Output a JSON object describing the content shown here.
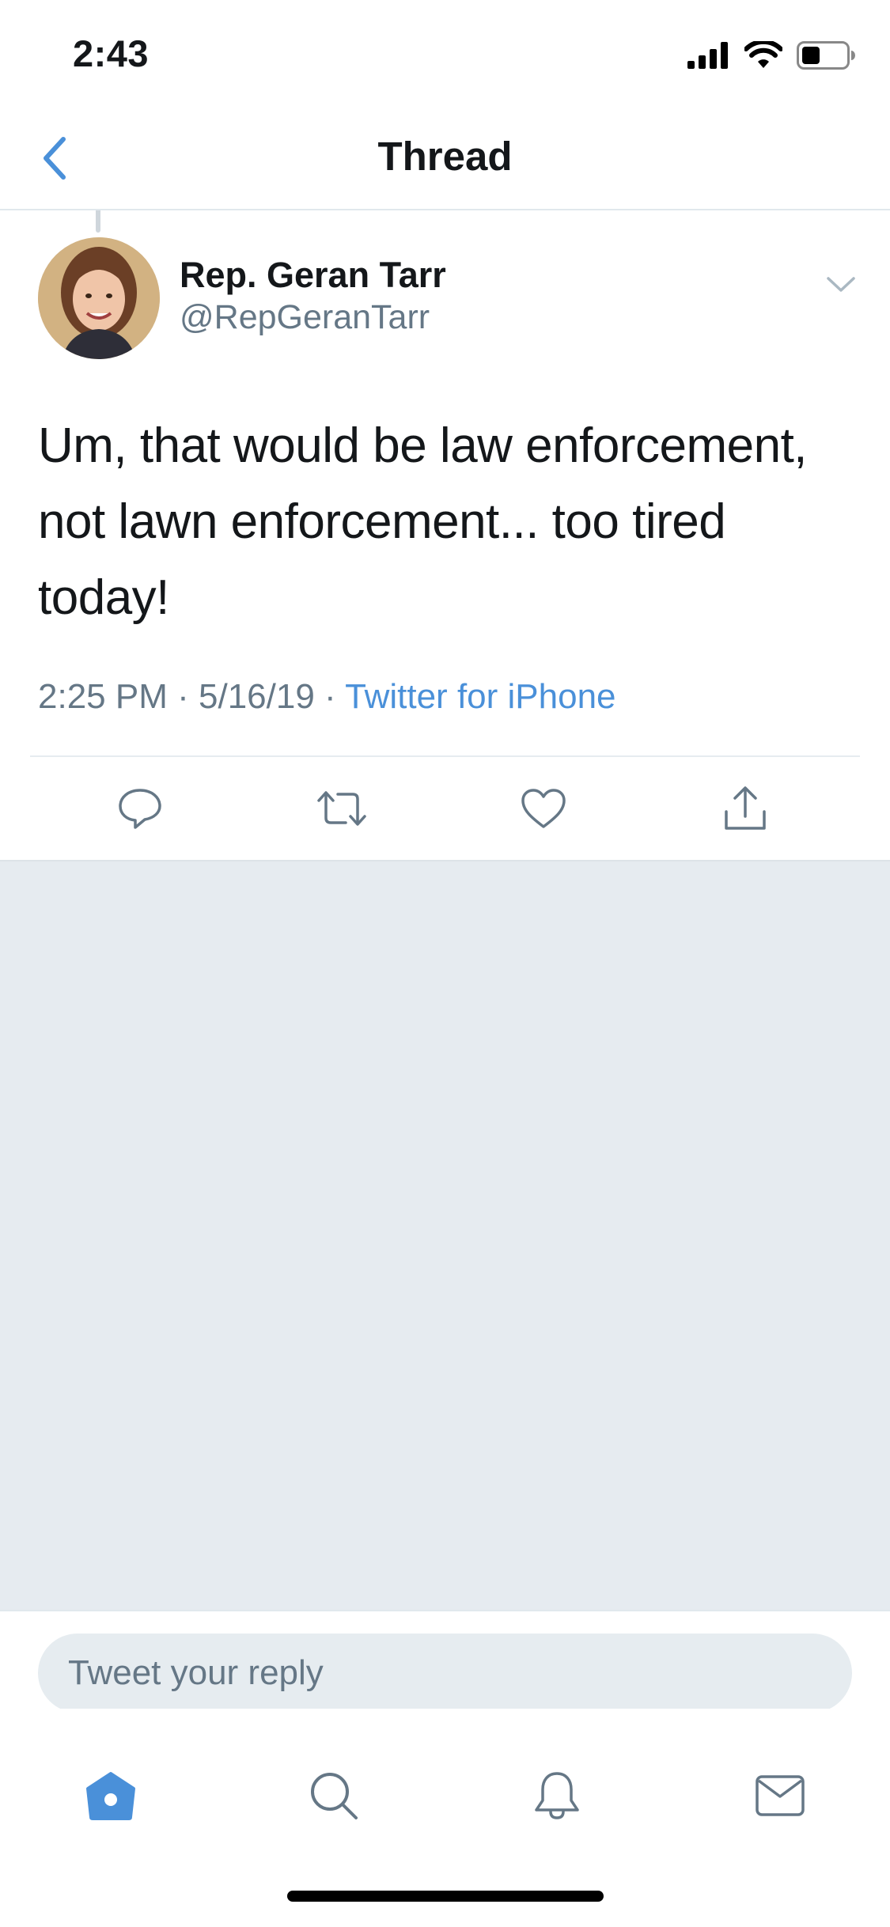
{
  "status_bar": {
    "time": "2:43",
    "icons": [
      "signal-icon",
      "wifi-icon",
      "battery-icon"
    ]
  },
  "header": {
    "title": "Thread",
    "back_icon": "chevron-left-icon"
  },
  "tweet": {
    "author_name": "Rep. Geran Tarr",
    "author_handle": "@RepGeranTarr",
    "text": "Um, that would be law enforcement, not lawn enforcement... too tired today!",
    "time": "2:25 PM",
    "date": "5/16/19",
    "separator": "·",
    "source": "Twitter for iPhone",
    "menu_icon": "chevron-down-icon",
    "actions": [
      "reply-icon",
      "retweet-icon",
      "like-icon",
      "share-icon"
    ]
  },
  "composer": {
    "placeholder": "Tweet your reply",
    "value": ""
  },
  "tab_bar": {
    "tabs": [
      "home-icon",
      "search-icon",
      "notifications-icon",
      "messages-icon"
    ],
    "active": "home"
  },
  "colors": {
    "accent": "#4a90d9",
    "text_primary": "#14171a",
    "text_secondary": "#657786",
    "background_empty": "#e6ebf0",
    "divider": "#e1e8ed"
  }
}
